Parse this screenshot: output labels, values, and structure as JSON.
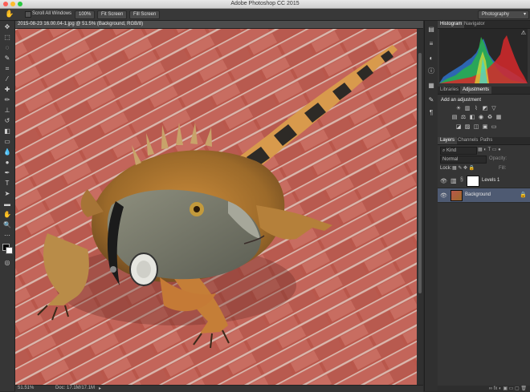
{
  "app": {
    "title": "Adobe Photoshop CC 2015"
  },
  "options": {
    "scroll_all_windows": "Scroll All Windows",
    "zoom_100": "100%",
    "fit_screen": "Fit Screen",
    "fill_screen": "Fill Screen",
    "workspace": "Photography"
  },
  "document": {
    "tab_name": "2015-08-23 16.00.04-1.jpg @ 51.5% (Background, RGB/8)",
    "zoom": "51.51%",
    "doc_size": "Doc: 17.1M/17.1M"
  },
  "histogram": {
    "tab_histogram": "Histogram",
    "tab_navigator": "Navigator"
  },
  "adjustments": {
    "tab_libraries": "Libraries",
    "tab_adjustments": "Adjustments",
    "title": "Add an adjustment"
  },
  "layers": {
    "tab_layers": "Layers",
    "tab_channels": "Channels",
    "tab_paths": "Paths",
    "kind": "Kind",
    "blend_mode": "Normal",
    "opacity_label": "Opacity:",
    "lock_label": "Lock:",
    "fill_label": "Fill:",
    "items": [
      {
        "name": "Levels 1"
      },
      {
        "name": "Background"
      }
    ]
  },
  "colors": {
    "accent": "#6d84b4",
    "ui_dark": "#353535"
  }
}
